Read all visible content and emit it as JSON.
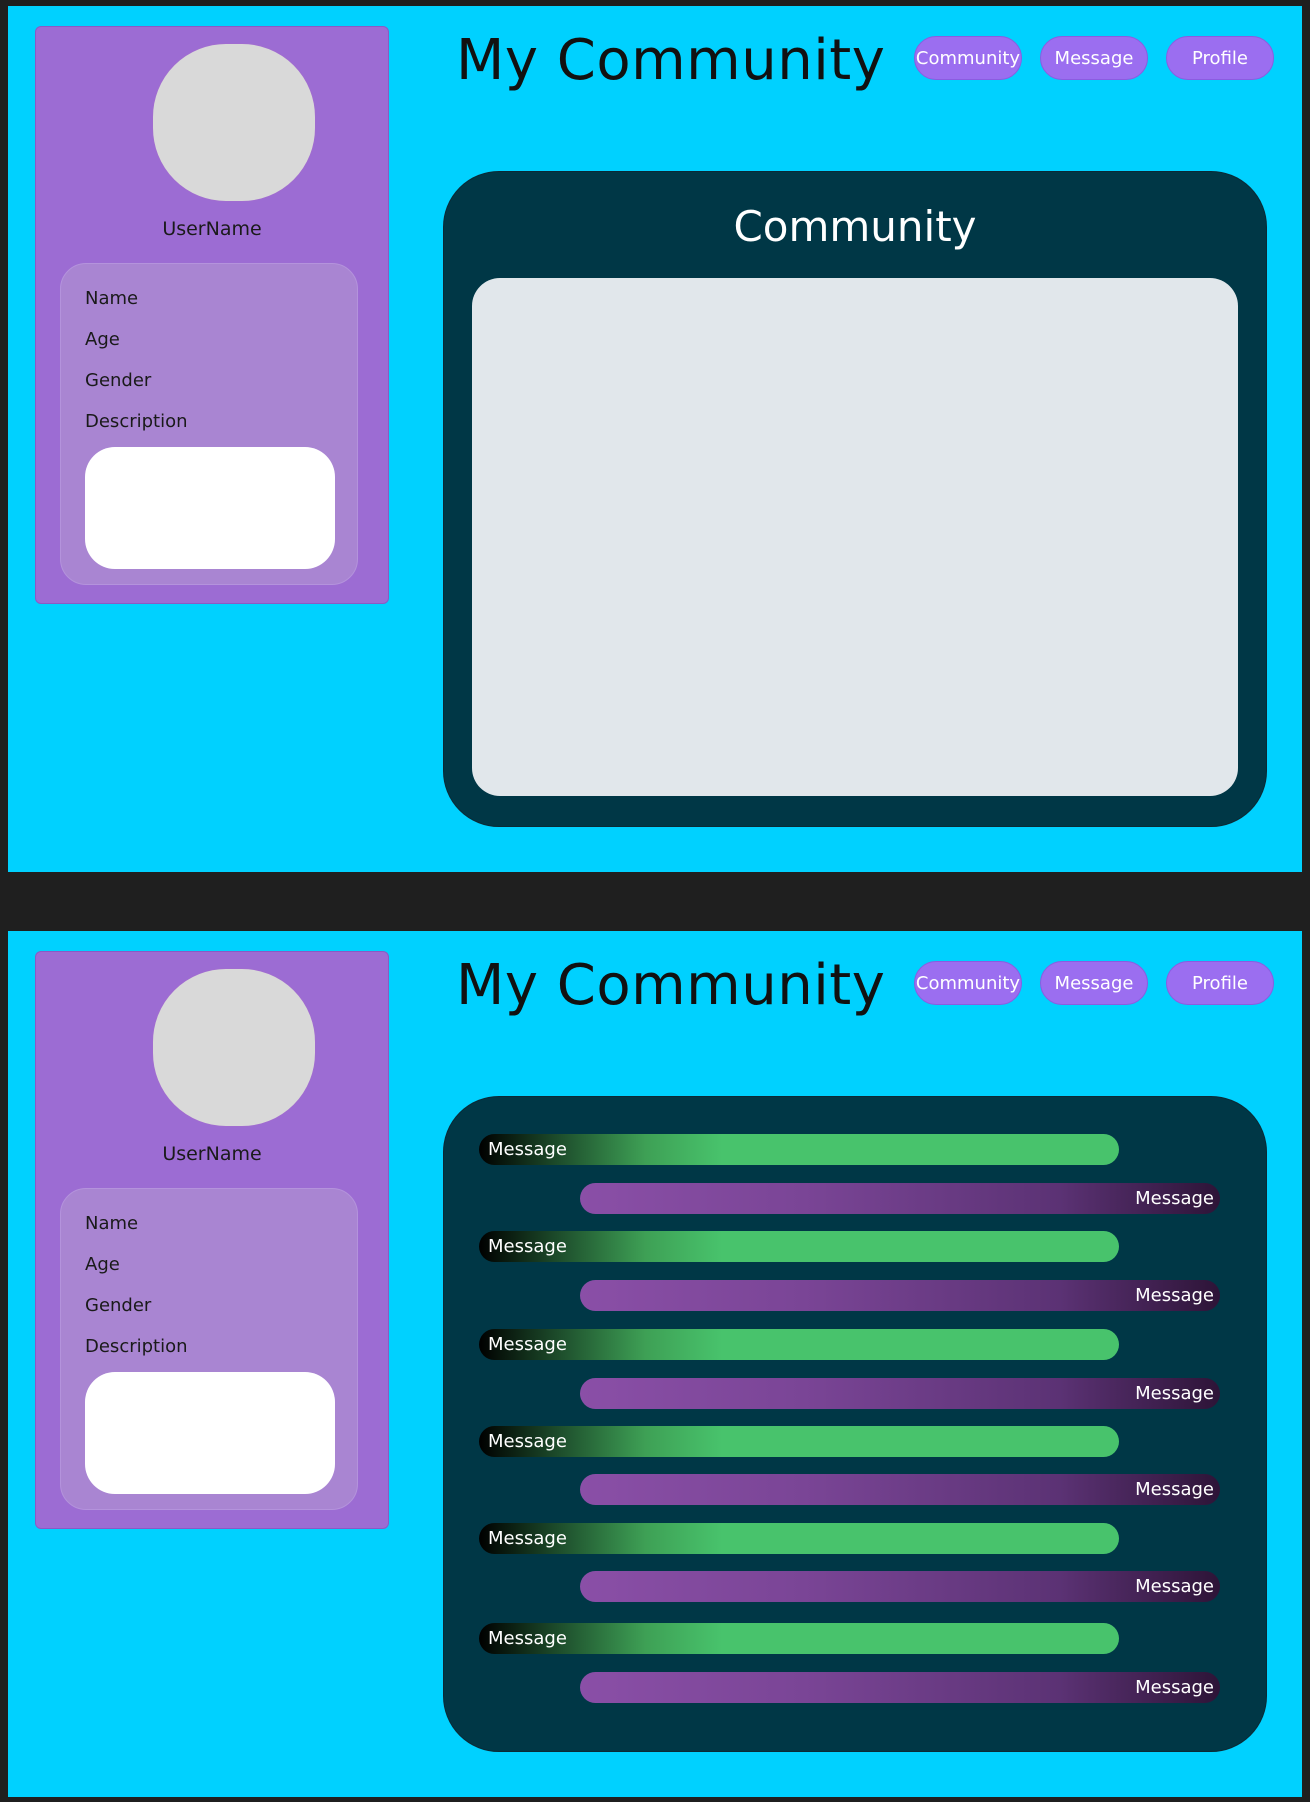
{
  "app": {
    "title": "My Community"
  },
  "nav": {
    "community_label": "Community",
    "message_label": "Message",
    "profile_label": "Profile"
  },
  "profile": {
    "username": "UserName",
    "fields": {
      "name": "Name",
      "age": "Age",
      "gender": "Gender",
      "description": "Description"
    }
  },
  "community_panel": {
    "title": "Community"
  },
  "messages": [
    {
      "direction": "incoming",
      "text": "Message"
    },
    {
      "direction": "outgoing",
      "text": "Message"
    },
    {
      "direction": "incoming",
      "text": "Message"
    },
    {
      "direction": "outgoing",
      "text": "Message"
    },
    {
      "direction": "incoming",
      "text": "Message"
    },
    {
      "direction": "outgoing",
      "text": "Message"
    },
    {
      "direction": "incoming",
      "text": "Message"
    },
    {
      "direction": "outgoing",
      "text": "Message"
    },
    {
      "direction": "incoming",
      "text": "Message"
    },
    {
      "direction": "outgoing",
      "text": "Message"
    },
    {
      "direction": "incoming",
      "text": "Message"
    },
    {
      "direction": "outgoing",
      "text": "Message"
    }
  ],
  "colors": {
    "background": "#00d1ff",
    "sidebar": "#9c6cd3",
    "info_card": "#a985d2",
    "nav_button": "#9b6ef0",
    "panel": "#003746",
    "panel_content": "#e1e7eb",
    "incoming_message": "#48c36c",
    "outgoing_message": "#7a4596"
  }
}
